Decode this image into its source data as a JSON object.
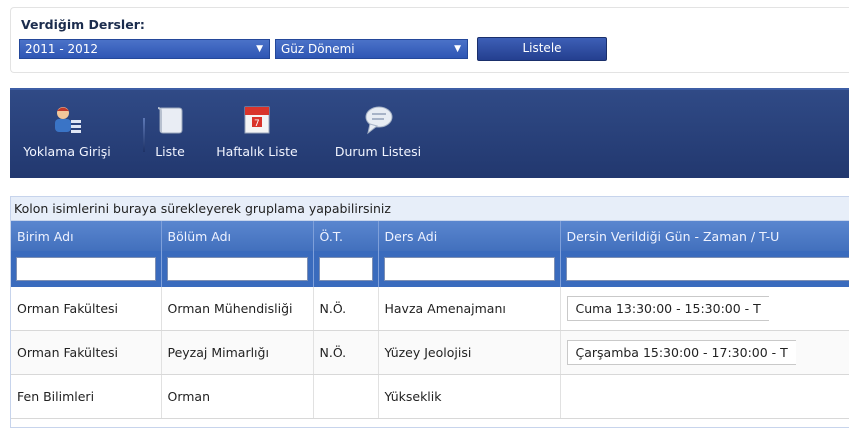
{
  "filter": {
    "title": "Verdiğim Dersler:",
    "year_value": "2011 - 2012",
    "term_value": "Güz Dönemi",
    "list_button": "Listele"
  },
  "toolbar": {
    "items": [
      {
        "label": "Yoklama Girişi",
        "icon": "user-check-icon"
      },
      {
        "label": "Liste",
        "icon": "scroll-icon"
      },
      {
        "label": "Haftalık Liste",
        "icon": "calendar-icon"
      },
      {
        "label": "Durum Listesi",
        "icon": "chat-bubble-icon"
      }
    ]
  },
  "grid": {
    "group_hint": "Kolon isimlerini buraya sürekleyerek gruplama yapabilirsiniz",
    "columns": [
      "Birim Adı",
      "Bölüm Adı",
      "Ö.T.",
      "Ders Adi",
      "Dersin Verildiği Gün - Zaman / T-U"
    ],
    "rows": [
      [
        "Orman Fakültesi",
        "Orman Mühendisliği",
        "N.Ö.",
        "Havza Amenajmanı",
        "Cuma 13:30:00 - 15:30:00 - T"
      ],
      [
        "Orman Fakültesi",
        "Peyzaj Mimarlığı",
        "N.Ö.",
        "Yüzey Jeolojisi",
        "Çarşamba 15:30:00 - 17:30:00 - T"
      ],
      [
        "Fen Bilimleri",
        "Orman",
        "",
        "Yükseklik",
        ""
      ]
    ]
  },
  "colors": {
    "toolbar_bg": "#2a4279",
    "header_bg": "#4a78c4",
    "select_bg": "#3a62c0"
  }
}
